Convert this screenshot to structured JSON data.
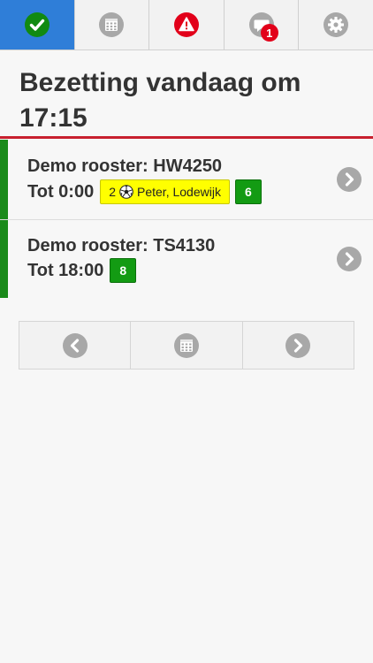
{
  "tabs": [
    {
      "icon": "check-icon",
      "active": true
    },
    {
      "icon": "calendar-icon",
      "active": false
    },
    {
      "icon": "warning-icon",
      "active": false
    },
    {
      "icon": "message-icon",
      "active": false,
      "badge": "1"
    },
    {
      "icon": "gear-icon",
      "active": false
    }
  ],
  "page": {
    "title": "Bezetting vandaag om 17:15"
  },
  "rows": [
    {
      "title": "Demo rooster: HW4250",
      "time": "Tot 0:00",
      "chip": {
        "count": "2",
        "icon": "soccer-ball-icon",
        "names": "Peter, Lodewijk"
      },
      "badge": "6"
    },
    {
      "title": "Demo rooster: TS4130",
      "time": "Tot 18:00",
      "badge": "8"
    }
  ],
  "pager": [
    {
      "icon": "chevron-left-icon"
    },
    {
      "icon": "calendar-icon"
    },
    {
      "icon": "chevron-right-icon"
    }
  ],
  "colors": {
    "active_tab": "#2f7ed8",
    "title_rule": "#c8202e",
    "row_stripe": "#1a8a1a",
    "chip_bg": "#ffff00",
    "count_bg": "#139b13",
    "badge_bg": "#e2001a"
  }
}
